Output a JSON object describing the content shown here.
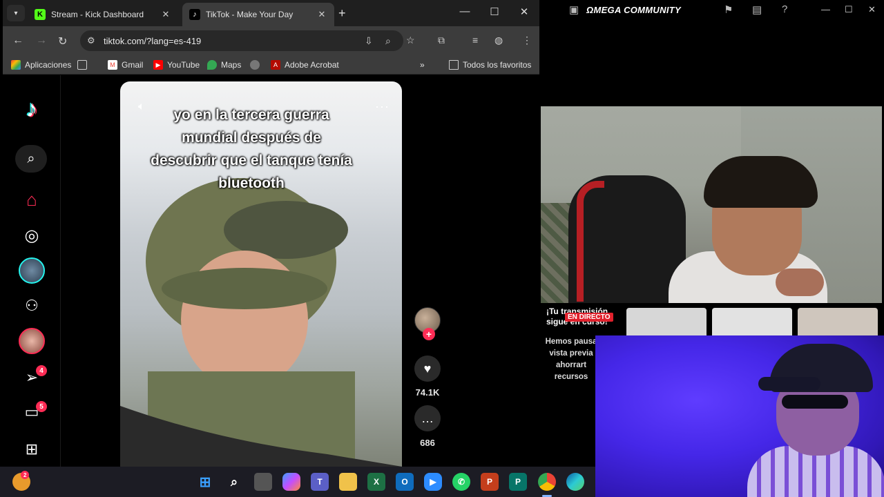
{
  "browser": {
    "tabs": [
      {
        "title": "Stream - Kick Dashboard",
        "active": false
      },
      {
        "title": "TikTok - Make Your Day",
        "active": true
      }
    ],
    "url": "tiktok.com/?lang=es-419",
    "bookmarks": [
      {
        "label": "Aplicaciones",
        "icon": "apps-grid-icon"
      },
      {
        "label": "Gmail",
        "icon": "gmail-icon"
      },
      {
        "label": "YouTube",
        "icon": "youtube-icon"
      },
      {
        "label": "Maps",
        "icon": "maps-icon"
      },
      {
        "label": "Adobe Acrobat",
        "icon": "acrobat-icon"
      }
    ],
    "all_bookmarks": "Todos los favoritos"
  },
  "tiktok": {
    "nav_badges": {
      "inbox": "4",
      "messages": "5"
    },
    "video": {
      "caption": "yo en la tercera guerra mundial después de descubrir que el tanque tenía bluetooth",
      "likes": "74.1K",
      "comments": "686"
    }
  },
  "stream_app": {
    "title": "ΩMEGA COMMUNITY",
    "live_card": {
      "title": "¡Tu transmisión sigue en curso!",
      "badge": "EN DIRECTO",
      "description": "Hemos pausa vista previa ahorrart recursos"
    }
  },
  "taskbar": {
    "notification_badge": "2",
    "apps": [
      "windows-start",
      "search",
      "task-view",
      "copilot",
      "teams",
      "file-explorer",
      "excel",
      "outlook",
      "zoom",
      "whatsapp",
      "powerpoint",
      "publisher",
      "chrome",
      "edge"
    ]
  },
  "colors": {
    "tiktok_red": "#fe2c55",
    "tiktok_cyan": "#25f4ee",
    "live_red": "#e0212c",
    "chrome_dark": "#3c3c3c"
  }
}
